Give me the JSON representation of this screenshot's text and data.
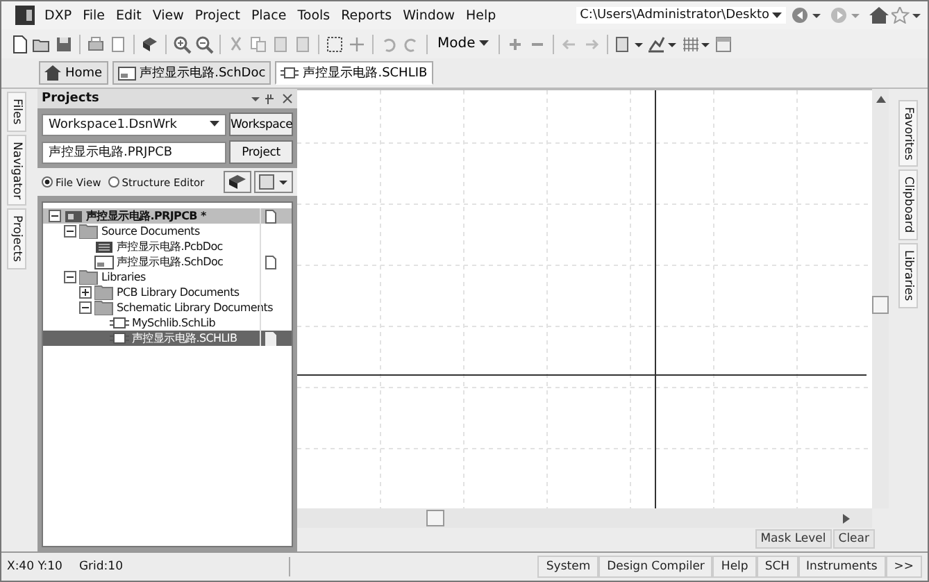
{
  "menu": {
    "app": "DXP",
    "items": [
      "File",
      "Edit",
      "View",
      "Project",
      "Place",
      "Tools",
      "Reports",
      "Window",
      "Help"
    ]
  },
  "path_field": {
    "value": "C:\\Users\\Administrator\\Deskto"
  },
  "toolbar": {
    "mode": "Mode"
  },
  "doc_tabs": [
    {
      "label": "Home",
      "kind": "home",
      "selected": false
    },
    {
      "label": "声控显示电路.SchDoc",
      "kind": "sch",
      "selected": false
    },
    {
      "label": "声控显示电路.SCHLIB",
      "kind": "lib",
      "selected": true
    }
  ],
  "left_tabs": [
    "Files",
    "Navigator",
    "Projects"
  ],
  "right_tabs": [
    "Favorites",
    "Clipboard",
    "Libraries"
  ],
  "projects_panel": {
    "title": "Projects",
    "workspace": "Workspace1.DsnWrk",
    "workspace_button": "Workspace",
    "project": "声控显示电路.PRJPCB",
    "project_button": "Project",
    "views": [
      {
        "label": "File View",
        "selected": true
      },
      {
        "label": "Structure Editor",
        "selected": false
      }
    ],
    "tree": [
      {
        "label": "声控显示电路.PRJPCB *",
        "kind": "project",
        "selected": false,
        "expanded": true,
        "doc_mark": true,
        "children": [
          {
            "label": "Source Documents",
            "kind": "folder",
            "selected": false,
            "expanded": true,
            "doc_mark": false,
            "children": [
              {
                "label": "声控显示电路.PcbDoc",
                "kind": "pcb",
                "selected": false,
                "doc_mark": false
              },
              {
                "label": "声控显示电路.SchDoc",
                "kind": "sch",
                "selected": false,
                "doc_mark": true
              }
            ]
          },
          {
            "label": "Libraries",
            "kind": "folder",
            "selected": false,
            "expanded": true,
            "doc_mark": false,
            "children": [
              {
                "label": "PCB Library Documents",
                "kind": "folder",
                "selected": false,
                "expanded": false,
                "doc_mark": false
              },
              {
                "label": "Schematic Library Documents",
                "kind": "folder",
                "selected": false,
                "expanded": true,
                "doc_mark": false,
                "children": [
                  {
                    "label": "MySchlib.SchLib",
                    "kind": "lib",
                    "selected": false,
                    "doc_mark": false
                  },
                  {
                    "label": "声控显示电路.SCHLIB",
                    "kind": "lib",
                    "selected": true,
                    "doc_mark": true
                  }
                ]
              }
            ]
          }
        ]
      }
    ]
  },
  "canvas_buttons": [
    "Mask Level",
    "Clear"
  ],
  "status_bar": {
    "coords": "X:40 Y:10",
    "grid": "Grid:10",
    "buttons": [
      "System",
      "Design Compiler",
      "Help",
      "SCH",
      "Instruments",
      ">>"
    ]
  }
}
